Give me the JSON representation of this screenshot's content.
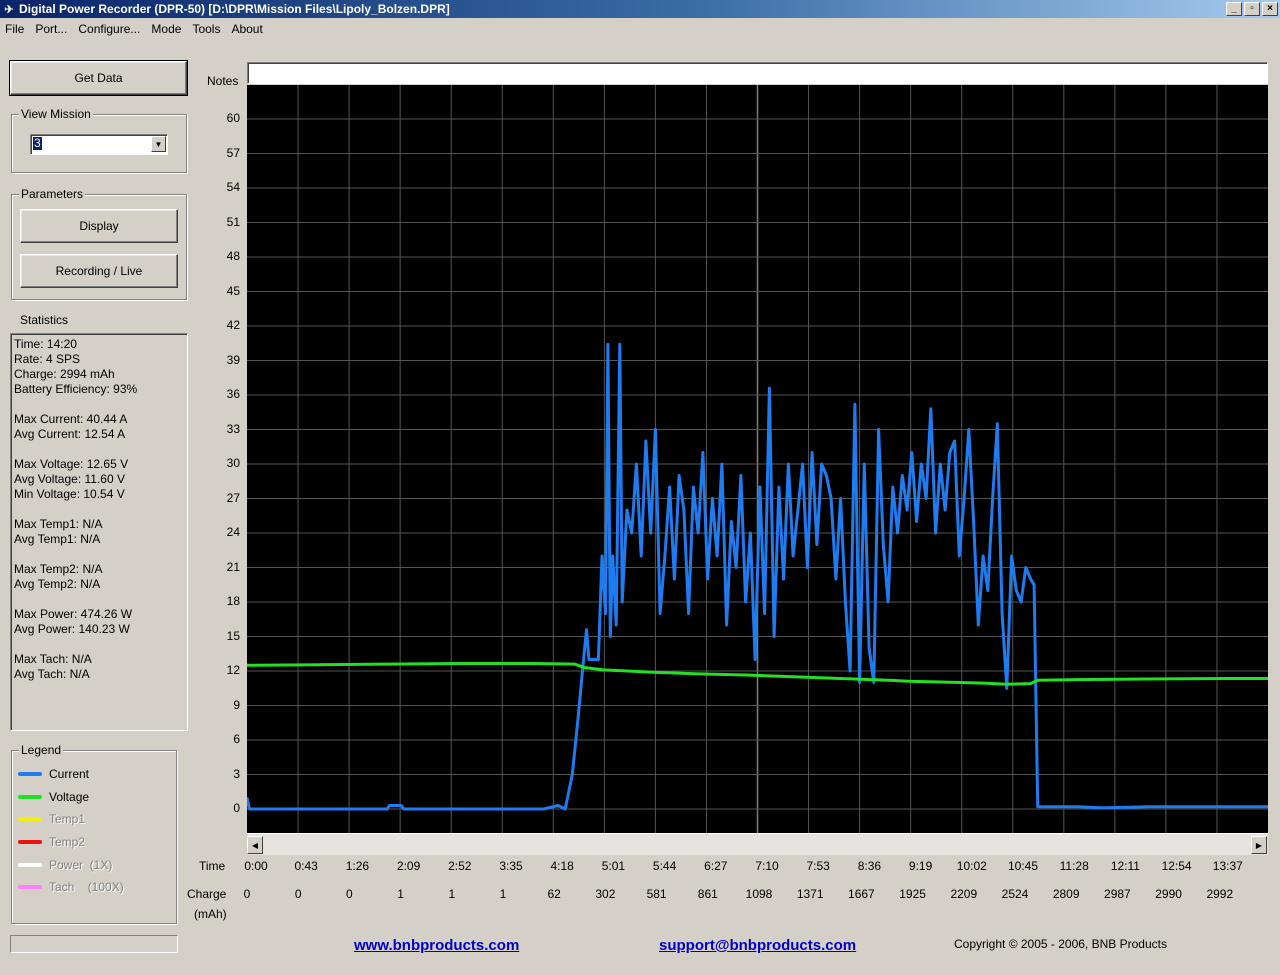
{
  "window": {
    "title": "Digital Power Recorder (DPR-50) [D:\\DPR\\Mission Files\\Lipoly_Bolzen.DPR]",
    "controls": [
      "_",
      "▫",
      "×"
    ]
  },
  "menu": [
    "File",
    "Port...",
    "Configure...",
    "Mode",
    "Tools",
    "About"
  ],
  "sidebar": {
    "get_data_label": "Get Data",
    "view_mission_title": "View Mission",
    "view_mission_value": "3",
    "parameters_title": "Parameters",
    "display_label": "Display",
    "recording_label": "Recording / Live",
    "statistics_title": "Statistics",
    "stats": [
      "Time: 14:20",
      "Rate: 4 SPS",
      "Charge: 2994 mAh",
      "Battery Efficiency: 93%",
      "",
      "Max Current: 40.44 A",
      "Avg Current: 12.54 A",
      "",
      "Max Voltage: 12.65 V",
      "Avg Voltage: 11.60 V",
      "Min Voltage: 10.54 V",
      "",
      "Max Temp1: N/A",
      "Avg Temp1: N/A",
      "",
      "Max Temp2: N/A",
      "Avg Temp2: N/A",
      "",
      "Max Power: 474.26 W",
      "Avg Power: 140.23 W",
      "",
      "Max Tach: N/A",
      "Avg Tach: N/A"
    ],
    "legend_title": "Legend",
    "legend": [
      {
        "label": "Current",
        "color": "#1e7bf0",
        "active": true
      },
      {
        "label": "Voltage",
        "color": "#22e022",
        "active": true
      },
      {
        "label": "Temp1",
        "color": "#f0f000",
        "active": false
      },
      {
        "label": "Temp2",
        "color": "#f01010",
        "active": false
      },
      {
        "label": "Power  (1X)",
        "color": "#ffffff",
        "active": false
      },
      {
        "label": "Tach    (100X)",
        "color": "#ff80ff",
        "active": false
      }
    ]
  },
  "notes_label": "Notes",
  "notes_value": "",
  "x_row_labels": {
    "time": "Time",
    "charge": "Charge",
    "charge_unit": "(mAh)"
  },
  "footer": {
    "link1": "www.bnbproducts.com",
    "link2": "support@bnbproducts.com",
    "copyright": "Copyright © 2005 - 2006, BNB Products"
  },
  "chart_data": {
    "type": "line",
    "y_ticks": [
      0,
      3,
      6,
      9,
      12,
      15,
      18,
      21,
      24,
      27,
      30,
      33,
      36,
      39,
      42,
      45,
      48,
      51,
      54,
      57,
      60
    ],
    "ylim": [
      0,
      63
    ],
    "time_labels": [
      "0:00",
      "0:43",
      "1:26",
      "2:09",
      "2:52",
      "3:35",
      "4:18",
      "5:01",
      "5:44",
      "6:27",
      "7:10",
      "7:53",
      "8:36",
      "9:19",
      "10:02",
      "10:45",
      "11:28",
      "12:11",
      "12:54",
      "13:37"
    ],
    "charge_labels": [
      "0",
      "0",
      "0",
      "1",
      "1",
      "1",
      "62",
      "302",
      "581",
      "861",
      "1098",
      "1371",
      "1667",
      "1925",
      "2209",
      "2524",
      "2809",
      "2987",
      "2990",
      "2992"
    ],
    "grid": true,
    "x_seconds_max": 860,
    "series": [
      {
        "name": "Current",
        "color": "#1e7bf0",
        "points": [
          [
            0,
            1
          ],
          [
            2,
            0
          ],
          [
            60,
            0
          ],
          [
            118,
            0
          ],
          [
            120,
            0.3
          ],
          [
            130,
            0.3
          ],
          [
            132,
            0
          ],
          [
            250,
            0
          ],
          [
            262,
            0.3
          ],
          [
            268,
            0
          ],
          [
            274,
            3
          ],
          [
            279,
            8
          ],
          [
            283,
            12.5
          ],
          [
            286,
            15.6
          ],
          [
            288,
            13
          ],
          [
            296,
            13
          ],
          [
            299,
            22
          ],
          [
            302,
            17
          ],
          [
            304,
            40.4
          ],
          [
            306,
            15
          ],
          [
            308,
            22
          ],
          [
            311,
            16
          ],
          [
            314,
            40.4
          ],
          [
            316,
            18
          ],
          [
            320,
            26
          ],
          [
            324,
            24
          ],
          [
            328,
            30
          ],
          [
            332,
            22
          ],
          [
            336,
            32
          ],
          [
            340,
            24
          ],
          [
            344,
            33
          ],
          [
            348,
            17
          ],
          [
            352,
            22
          ],
          [
            356,
            28
          ],
          [
            360,
            20
          ],
          [
            364,
            29
          ],
          [
            368,
            26
          ],
          [
            372,
            17
          ],
          [
            376,
            28
          ],
          [
            380,
            24
          ],
          [
            384,
            31
          ],
          [
            388,
            20
          ],
          [
            392,
            27
          ],
          [
            396,
            22
          ],
          [
            400,
            30
          ],
          [
            404,
            16
          ],
          [
            408,
            25
          ],
          [
            412,
            21
          ],
          [
            416,
            29
          ],
          [
            420,
            18
          ],
          [
            424,
            24
          ],
          [
            428,
            13
          ],
          [
            432,
            28
          ],
          [
            436,
            17
          ],
          [
            440,
            36.6
          ],
          [
            444,
            15
          ],
          [
            448,
            28
          ],
          [
            452,
            20
          ],
          [
            456,
            30
          ],
          [
            460,
            22
          ],
          [
            464,
            26
          ],
          [
            468,
            30
          ],
          [
            472,
            21
          ],
          [
            476,
            31
          ],
          [
            480,
            23
          ],
          [
            484,
            30
          ],
          [
            488,
            29
          ],
          [
            492,
            27
          ],
          [
            496,
            20
          ],
          [
            500,
            27
          ],
          [
            504,
            18
          ],
          [
            508,
            12
          ],
          [
            512,
            35.2
          ],
          [
            516,
            11
          ],
          [
            520,
            30
          ],
          [
            524,
            14
          ],
          [
            528,
            11
          ],
          [
            532,
            33
          ],
          [
            536,
            23
          ],
          [
            540,
            18
          ],
          [
            544,
            28
          ],
          [
            548,
            24
          ],
          [
            552,
            29
          ],
          [
            556,
            26
          ],
          [
            560,
            31
          ],
          [
            564,
            25
          ],
          [
            568,
            30
          ],
          [
            572,
            27
          ],
          [
            576,
            34.8
          ],
          [
            580,
            24
          ],
          [
            584,
            30
          ],
          [
            588,
            26
          ],
          [
            592,
            31
          ],
          [
            596,
            32
          ],
          [
            600,
            22
          ],
          [
            604,
            27
          ],
          [
            608,
            33
          ],
          [
            612,
            25
          ],
          [
            616,
            16
          ],
          [
            620,
            22
          ],
          [
            624,
            19
          ],
          [
            628,
            27
          ],
          [
            632,
            33.5
          ],
          [
            636,
            17
          ],
          [
            640,
            10.5
          ],
          [
            644,
            22
          ],
          [
            648,
            19
          ],
          [
            652,
            18
          ],
          [
            656,
            21
          ],
          [
            660,
            20
          ],
          [
            663,
            19.5
          ],
          [
            666,
            0.2
          ],
          [
            680,
            0.2
          ],
          [
            700,
            0.2
          ],
          [
            720,
            0.1
          ],
          [
            760,
            0.2
          ],
          [
            800,
            0.2
          ],
          [
            860,
            0.2
          ]
        ]
      },
      {
        "name": "Voltage",
        "color": "#22e022",
        "points": [
          [
            0,
            12.5
          ],
          [
            60,
            12.55
          ],
          [
            120,
            12.6
          ],
          [
            180,
            12.65
          ],
          [
            240,
            12.65
          ],
          [
            276,
            12.6
          ],
          [
            284,
            12.3
          ],
          [
            300,
            12.1
          ],
          [
            340,
            11.9
          ],
          [
            380,
            11.75
          ],
          [
            420,
            11.65
          ],
          [
            460,
            11.5
          ],
          [
            500,
            11.35
          ],
          [
            540,
            11.2
          ],
          [
            560,
            11.1
          ],
          [
            580,
            11.05
          ],
          [
            620,
            10.95
          ],
          [
            640,
            10.85
          ],
          [
            660,
            10.9
          ],
          [
            666,
            11.2
          ],
          [
            700,
            11.25
          ],
          [
            760,
            11.3
          ],
          [
            820,
            11.35
          ],
          [
            860,
            11.35
          ]
        ]
      }
    ]
  }
}
